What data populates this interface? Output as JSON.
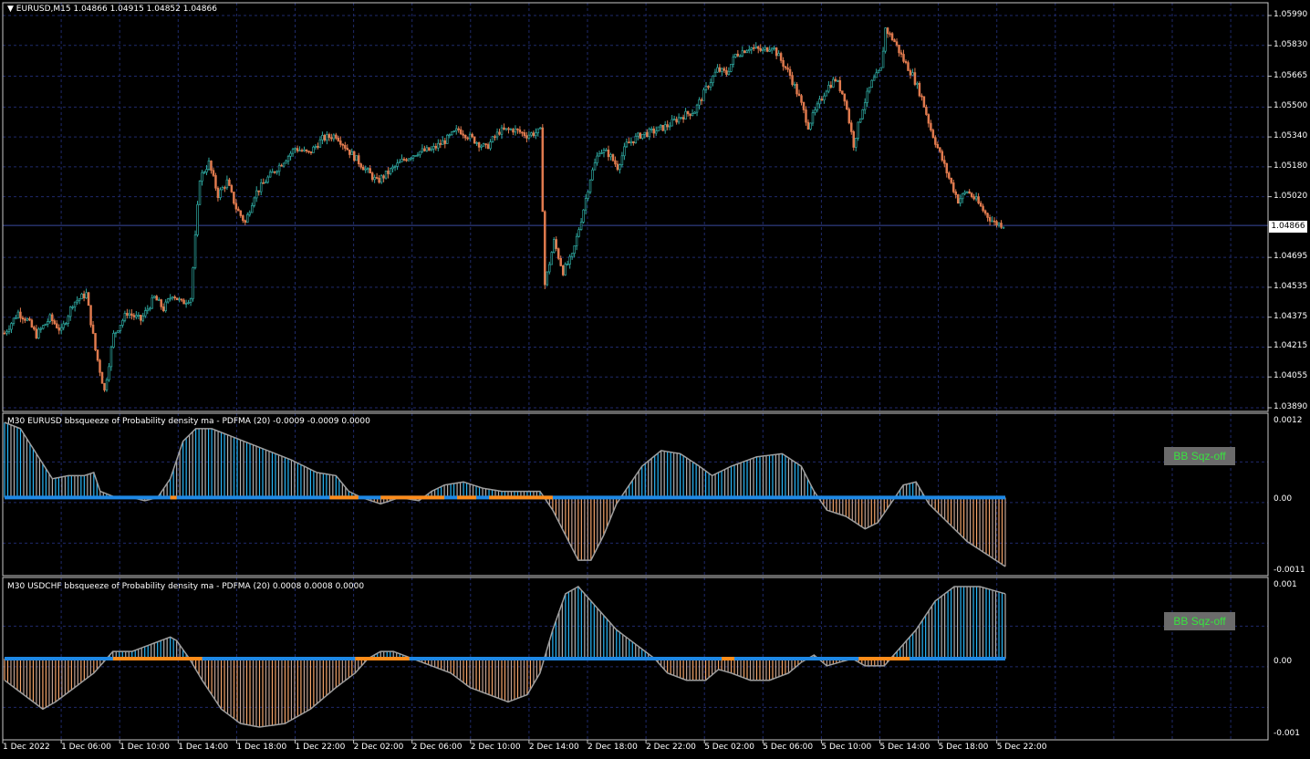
{
  "main": {
    "title": "EURUSD,M15  1.04866 1.04915 1.04852 1.04866",
    "price_labels": [
      "1.05990",
      "1.05830",
      "1.05665",
      "1.05500",
      "1.05340",
      "1.05180",
      "1.05020",
      "1.04695",
      "1.04535",
      "1.04375",
      "1.04215",
      "1.04055",
      "1.03890"
    ],
    "current_price": "1.04866",
    "colors": {
      "bull": "#2ea8a0",
      "bear": "#e07a4e",
      "grid": "#1f2a6b",
      "axis": "#c8c8c8"
    }
  },
  "panel1": {
    "title": "M30 EURUSD bbsqueeze of Probability density ma - PDFMA (20) -0.0009 -0.0009 0.0000",
    "scale": [
      "0.0012",
      "0.00",
      "-0.0011"
    ],
    "badge": "BB Sqz-off",
    "colors": {
      "positive": "#29b6f6",
      "negative": "#f4a46a",
      "line": "#9e9e9e",
      "dots_on": "#1e88e5",
      "dots_off": "#ff8c1a"
    }
  },
  "panel2": {
    "title": "M30 USDCHF bbsqueeze of Probability density ma - PDFMA (20) 0.0008 0.0008 0.0000",
    "scale": [
      "0.001",
      "0.00",
      "-0.001"
    ],
    "badge": "BB Sqz-off"
  },
  "time_axis": [
    "1 Dec 2022",
    "1 Dec 06:00",
    "1 Dec 10:00",
    "1 Dec 14:00",
    "1 Dec 18:00",
    "1 Dec 22:00",
    "2 Dec 02:00",
    "2 Dec 06:00",
    "2 Dec 10:00",
    "2 Dec 14:00",
    "2 Dec 18:00",
    "2 Dec 22:00",
    "5 Dec 02:00",
    "5 Dec 06:00",
    "5 Dec 10:00",
    "5 Dec 14:00",
    "5 Dec 18:00",
    "5 Dec 22:00"
  ],
  "chart_data": [
    {
      "type": "candlestick",
      "title": "EURUSD,M15",
      "ylim": [
        1.0389,
        1.0599
      ],
      "close_path_keypoints": [
        [
          0,
          1.0429
        ],
        [
          6,
          1.044
        ],
        [
          10,
          1.0436
        ],
        [
          14,
          1.0428
        ],
        [
          20,
          1.0437
        ],
        [
          25,
          1.043
        ],
        [
          30,
          1.0445
        ],
        [
          36,
          1.045
        ],
        [
          40,
          1.042
        ],
        [
          44,
          1.0398
        ],
        [
          48,
          1.0428
        ],
        [
          54,
          1.044
        ],
        [
          60,
          1.0436
        ],
        [
          66,
          1.0448
        ],
        [
          70,
          1.0442
        ],
        [
          74,
          1.045
        ],
        [
          78,
          1.0445
        ],
        [
          82,
          1.0448
        ],
        [
          86,
          1.0512
        ],
        [
          90,
          1.052
        ],
        [
          94,
          1.0503
        ],
        [
          98,
          1.051
        ],
        [
          102,
          1.0496
        ],
        [
          106,
          1.0488
        ],
        [
          110,
          1.0503
        ],
        [
          116,
          1.0512
        ],
        [
          122,
          1.052
        ],
        [
          128,
          1.0528
        ],
        [
          134,
          1.0525
        ],
        [
          140,
          1.0533
        ],
        [
          146,
          1.0535
        ],
        [
          152,
          1.0526
        ],
        [
          158,
          1.0518
        ],
        [
          164,
          1.051
        ],
        [
          170,
          1.0516
        ],
        [
          176,
          1.0522
        ],
        [
          182,
          1.0526
        ],
        [
          188,
          1.0527
        ],
        [
          194,
          1.0532
        ],
        [
          200,
          1.0538
        ],
        [
          206,
          1.0533
        ],
        [
          212,
          1.0528
        ],
        [
          218,
          1.0537
        ],
        [
          224,
          1.0538
        ],
        [
          230,
          1.0535
        ],
        [
          236,
          1.0537
        ],
        [
          238,
          1.0455
        ],
        [
          242,
          1.0478
        ],
        [
          246,
          1.0462
        ],
        [
          250,
          1.047
        ],
        [
          254,
          1.049
        ],
        [
          258,
          1.0512
        ],
        [
          262,
          1.0527
        ],
        [
          266,
          1.0525
        ],
        [
          270,
          1.0518
        ],
        [
          274,
          1.053
        ],
        [
          280,
          1.0535
        ],
        [
          286,
          1.0537
        ],
        [
          292,
          1.054
        ],
        [
          298,
          1.0545
        ],
        [
          304,
          1.0548
        ],
        [
          310,
          1.0562
        ],
        [
          314,
          1.057
        ],
        [
          318,
          1.0568
        ],
        [
          322,
          1.0578
        ],
        [
          328,
          1.0582
        ],
        [
          334,
          1.058
        ],
        [
          338,
          1.0583
        ],
        [
          342,
          1.0575
        ],
        [
          346,
          1.0567
        ],
        [
          350,
          1.0555
        ],
        [
          354,
          1.054
        ],
        [
          358,
          1.055
        ],
        [
          362,
          1.056
        ],
        [
          366,
          1.0565
        ],
        [
          370,
          1.0555
        ],
        [
          374,
          1.053
        ],
        [
          378,
          1.055
        ],
        [
          382,
          1.0563
        ],
        [
          386,
          1.057
        ],
        [
          388,
          1.0592
        ],
        [
          392,
          1.0585
        ],
        [
          396,
          1.0575
        ],
        [
          400,
          1.0567
        ],
        [
          404,
          1.0555
        ],
        [
          408,
          1.0538
        ],
        [
          412,
          1.0525
        ],
        [
          416,
          1.0512
        ],
        [
          420,
          1.05
        ],
        [
          424,
          1.0505
        ],
        [
          428,
          1.05
        ],
        [
          432,
          1.0493
        ],
        [
          436,
          1.0488
        ],
        [
          440,
          1.0487
        ]
      ]
    },
    {
      "type": "histogram",
      "title": "M30 EURUSD bbsqueeze of Probability density ma - PDFMA (20)",
      "ylim": [
        -0.0011,
        0.0012
      ],
      "values_keypoints": [
        [
          0,
          0.0012
        ],
        [
          5,
          0.0011
        ],
        [
          10,
          0.0007
        ],
        [
          15,
          0.0003
        ],
        [
          20,
          0.00035
        ],
        [
          25,
          0.00035
        ],
        [
          28,
          0.0004
        ],
        [
          30,
          0.0001
        ],
        [
          35,
          0.0
        ],
        [
          40,
          0.0
        ],
        [
          44,
          -5e-05
        ],
        [
          48,
          0.0
        ],
        [
          52,
          0.0003
        ],
        [
          56,
          0.0009
        ],
        [
          60,
          0.0011
        ],
        [
          65,
          0.0011
        ],
        [
          70,
          0.001
        ],
        [
          80,
          0.0008
        ],
        [
          90,
          0.0006
        ],
        [
          98,
          0.0004
        ],
        [
          104,
          0.00035
        ],
        [
          108,
          0.0001
        ],
        [
          112,
          0.0
        ],
        [
          118,
          -0.0001
        ],
        [
          124,
          0.0
        ],
        [
          130,
          -5e-05
        ],
        [
          134,
          0.0001
        ],
        [
          138,
          0.0002
        ],
        [
          144,
          0.00025
        ],
        [
          150,
          0.00015
        ],
        [
          156,
          0.0001
        ],
        [
          162,
          0.0001
        ],
        [
          168,
          0.0001
        ],
        [
          172,
          -0.0002
        ],
        [
          176,
          -0.0006
        ],
        [
          180,
          -0.001
        ],
        [
          184,
          -0.001
        ],
        [
          188,
          -0.0006
        ],
        [
          192,
          -0.0001
        ],
        [
          196,
          0.0002
        ],
        [
          200,
          0.0005
        ],
        [
          206,
          0.00075
        ],
        [
          212,
          0.0007
        ],
        [
          218,
          0.0005
        ],
        [
          222,
          0.00035
        ],
        [
          228,
          0.0005
        ],
        [
          236,
          0.00065
        ],
        [
          244,
          0.0007
        ],
        [
          250,
          0.0005
        ],
        [
          254,
          0.0001
        ],
        [
          258,
          -0.0002
        ],
        [
          264,
          -0.0003
        ],
        [
          270,
          -0.0005
        ],
        [
          274,
          -0.0004
        ],
        [
          278,
          -0.0001
        ],
        [
          282,
          0.0002
        ],
        [
          286,
          0.00025
        ],
        [
          290,
          -0.0001
        ],
        [
          296,
          -0.0004
        ],
        [
          302,
          -0.0007
        ],
        [
          308,
          -0.0009
        ],
        [
          314,
          -0.0011
        ]
      ]
    },
    {
      "type": "histogram",
      "title": "M30 USDCHF bbsqueeze of Probability density ma - PDFMA (20)",
      "ylim": [
        -0.001,
        0.001
      ],
      "values_keypoints": [
        [
          0,
          -0.0003
        ],
        [
          6,
          -0.0005
        ],
        [
          12,
          -0.0007
        ],
        [
          16,
          -0.0006
        ],
        [
          22,
          -0.0004
        ],
        [
          28,
          -0.0002
        ],
        [
          34,
          0.0001
        ],
        [
          40,
          0.0001
        ],
        [
          46,
          0.0002
        ],
        [
          52,
          0.0003
        ],
        [
          54,
          0.00025
        ],
        [
          58,
          0.0
        ],
        [
          62,
          -0.0003
        ],
        [
          68,
          -0.0007
        ],
        [
          74,
          -0.0009
        ],
        [
          80,
          -0.00095
        ],
        [
          88,
          -0.0009
        ],
        [
          96,
          -0.0007
        ],
        [
          104,
          -0.0004
        ],
        [
          110,
          -0.0002
        ],
        [
          114,
          0.0
        ],
        [
          118,
          0.0001
        ],
        [
          122,
          0.0001
        ],
        [
          128,
          0.0
        ],
        [
          134,
          -0.0001
        ],
        [
          140,
          -0.0002
        ],
        [
          146,
          -0.0004
        ],
        [
          152,
          -0.0005
        ],
        [
          158,
          -0.0006
        ],
        [
          164,
          -0.0005
        ],
        [
          168,
          -0.0002
        ],
        [
          172,
          0.0004
        ],
        [
          176,
          0.0009
        ],
        [
          180,
          0.001
        ],
        [
          186,
          0.0007
        ],
        [
          192,
          0.0004
        ],
        [
          198,
          0.0002
        ],
        [
          204,
          0.0
        ],
        [
          208,
          -0.0002
        ],
        [
          214,
          -0.0003
        ],
        [
          220,
          -0.0003
        ],
        [
          224,
          -0.00015
        ],
        [
          228,
          -0.0002
        ],
        [
          234,
          -0.0003
        ],
        [
          240,
          -0.0003
        ],
        [
          246,
          -0.0002
        ],
        [
          250,
          -5e-05
        ],
        [
          254,
          5e-05
        ],
        [
          258,
          -0.0001
        ],
        [
          262,
          -5e-05
        ],
        [
          266,
          0.0
        ],
        [
          270,
          -0.0001
        ],
        [
          276,
          -0.0001
        ],
        [
          280,
          0.0001
        ],
        [
          286,
          0.0004
        ],
        [
          292,
          0.0008
        ],
        [
          298,
          0.001
        ],
        [
          306,
          0.001
        ],
        [
          314,
          0.0009
        ]
      ]
    }
  ]
}
